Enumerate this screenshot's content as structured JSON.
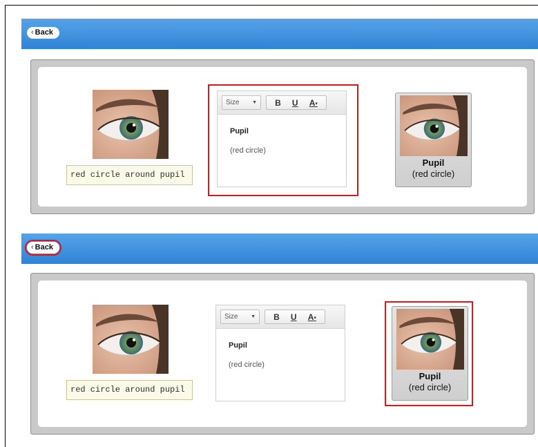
{
  "top": {
    "back_label": "Back",
    "image_caption": "red circle around pupil",
    "editor": {
      "size_label": "Size",
      "bold": "B",
      "underline": "U",
      "color": "A",
      "title": "Pupil",
      "subtitle": "(red circle)"
    },
    "preview": {
      "title": "Pupil",
      "subtitle": "(red circle)"
    },
    "highlighted": "editor"
  },
  "bottom": {
    "back_label": "Back",
    "image_caption": "red circle around pupil",
    "editor": {
      "size_label": "Size",
      "bold": "B",
      "underline": "U",
      "color": "A",
      "title": "Pupil",
      "subtitle": "(red circle)"
    },
    "preview": {
      "title": "Pupil",
      "subtitle": "(red circle)"
    },
    "highlighted": "back-button and preview-card"
  },
  "colors": {
    "accent_blue": "#3b8ddc",
    "highlight_red": "#d9161c"
  },
  "icons": [
    "chevron-left-icon",
    "dropdown-caret-icon",
    "eye-image"
  ]
}
